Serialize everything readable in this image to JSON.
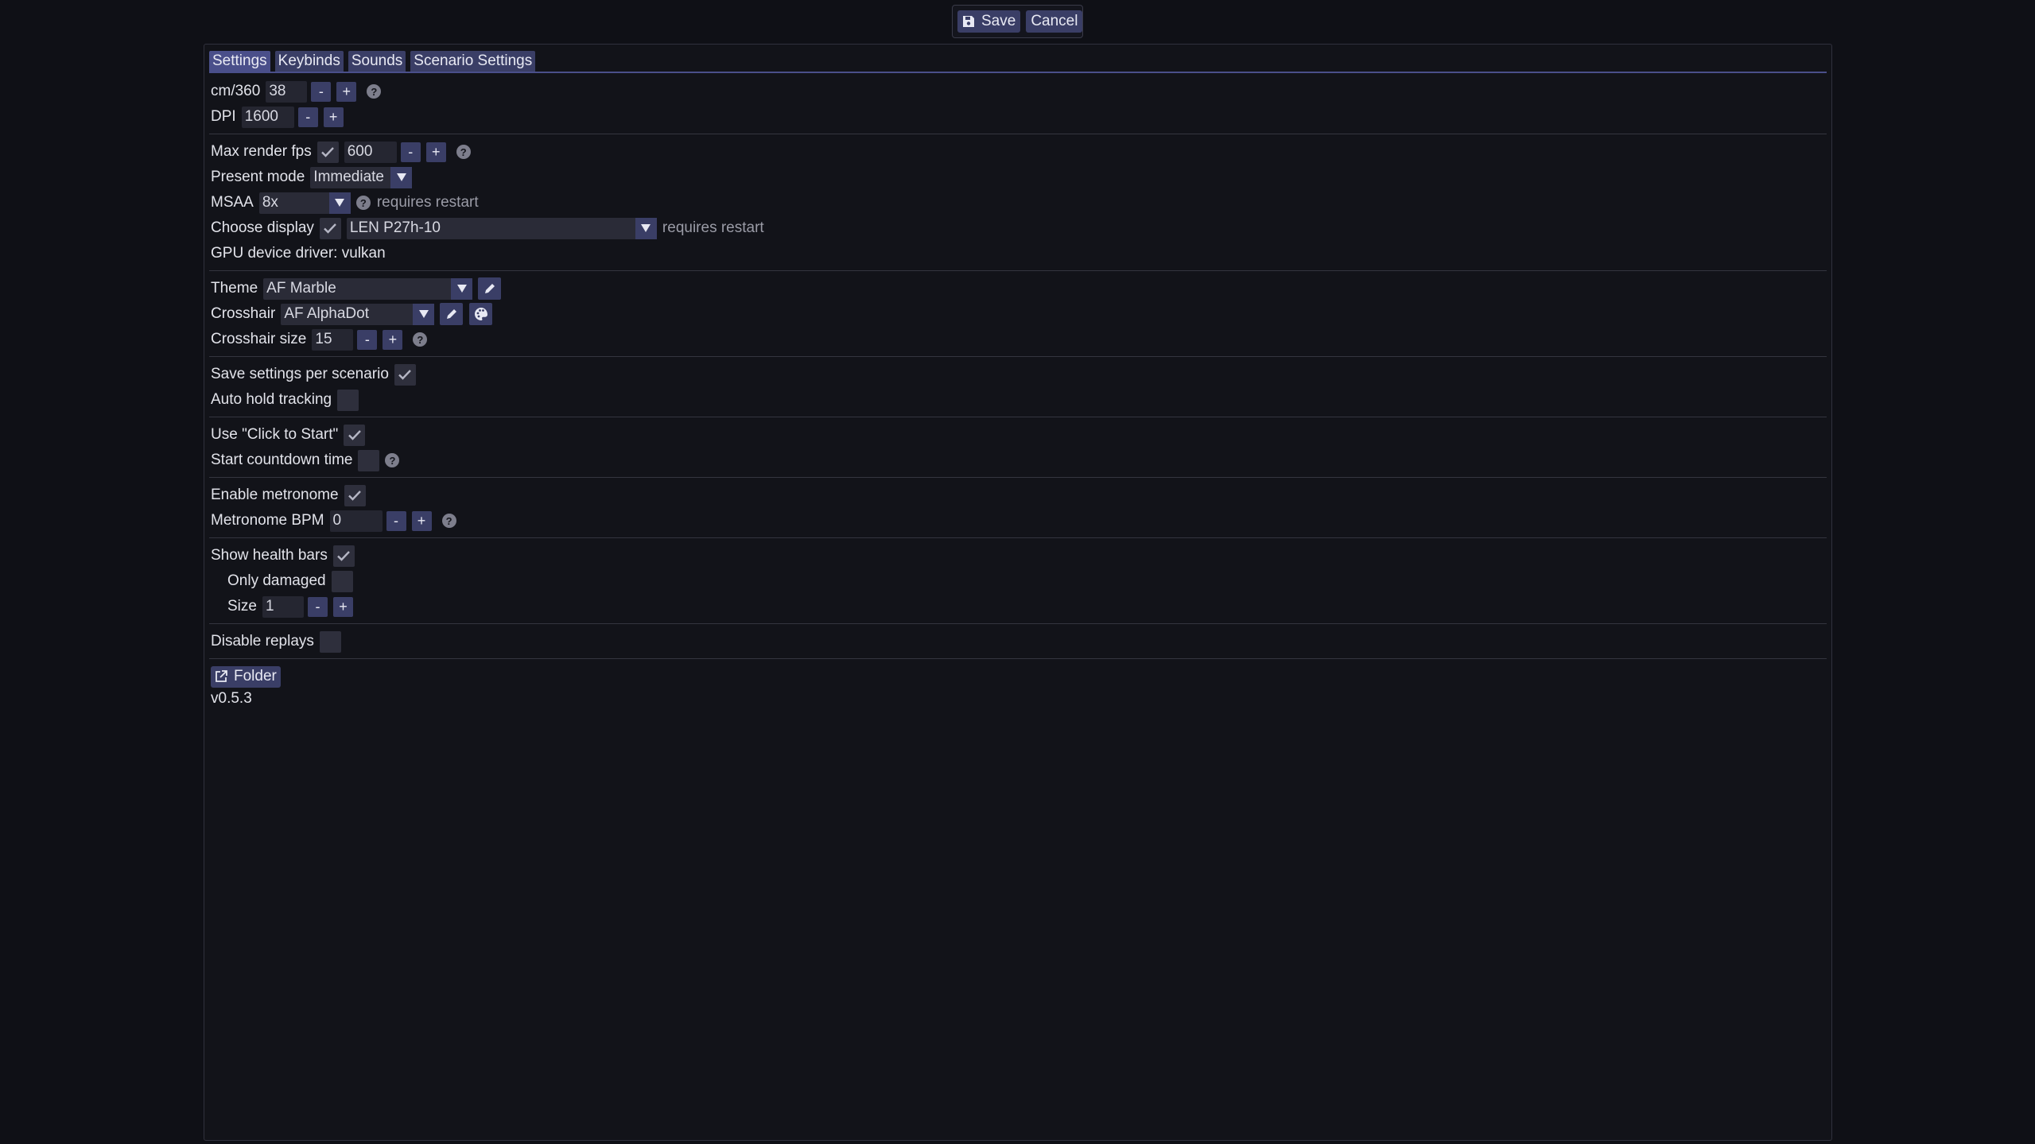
{
  "topbar": {
    "save_label": "Save",
    "cancel_label": "Cancel"
  },
  "tabs": [
    {
      "label": "Settings",
      "active": true
    },
    {
      "label": "Keybinds",
      "active": false
    },
    {
      "label": "Sounds",
      "active": false
    },
    {
      "label": "Scenario Settings",
      "active": false
    }
  ],
  "sensitivity": {
    "cm360_label": "cm/360",
    "cm360_value": "38",
    "dpi_label": "DPI",
    "dpi_value": "1600"
  },
  "stepper": {
    "minus": "-",
    "plus": "+"
  },
  "help_glyph": "?",
  "render": {
    "max_fps_label": "Max render fps",
    "max_fps_enabled": true,
    "max_fps_value": "600",
    "present_mode_label": "Present mode",
    "present_mode_value": "Immediate",
    "msaa_label": "MSAA",
    "msaa_value": "8x",
    "requires_restart": "requires restart",
    "choose_display_label": "Choose display",
    "choose_display_enabled": true,
    "display_value": "LEN P27h-10",
    "gpu_driver_text": "GPU device driver: vulkan"
  },
  "appearance": {
    "theme_label": "Theme",
    "theme_value": "AF Marble",
    "crosshair_label": "Crosshair",
    "crosshair_value": "AF AlphaDot",
    "crosshair_size_label": "Crosshair size",
    "crosshair_size_value": "15"
  },
  "scenario": {
    "save_per_scenario_label": "Save settings per scenario",
    "save_per_scenario_checked": true,
    "auto_hold_label": "Auto hold tracking",
    "auto_hold_checked": false
  },
  "start": {
    "click_to_start_label": "Use \"Click to Start\"",
    "click_to_start_checked": true,
    "countdown_label": "Start countdown time",
    "countdown_checked": false
  },
  "metronome": {
    "enable_label": "Enable metronome",
    "enable_checked": true,
    "bpm_label": "Metronome BPM",
    "bpm_value": "0"
  },
  "health": {
    "show_label": "Show health bars",
    "show_checked": true,
    "only_damaged_label": "Only damaged",
    "only_damaged_checked": false,
    "size_label": "Size",
    "size_value": "1"
  },
  "replays": {
    "disable_label": "Disable replays",
    "disable_checked": false
  },
  "footer": {
    "folder_label": "Folder",
    "version": "v0.5.3"
  },
  "colors": {
    "background": "#0f1016",
    "accent": "#3a3e66",
    "tab_active": "#4a4f8a"
  }
}
